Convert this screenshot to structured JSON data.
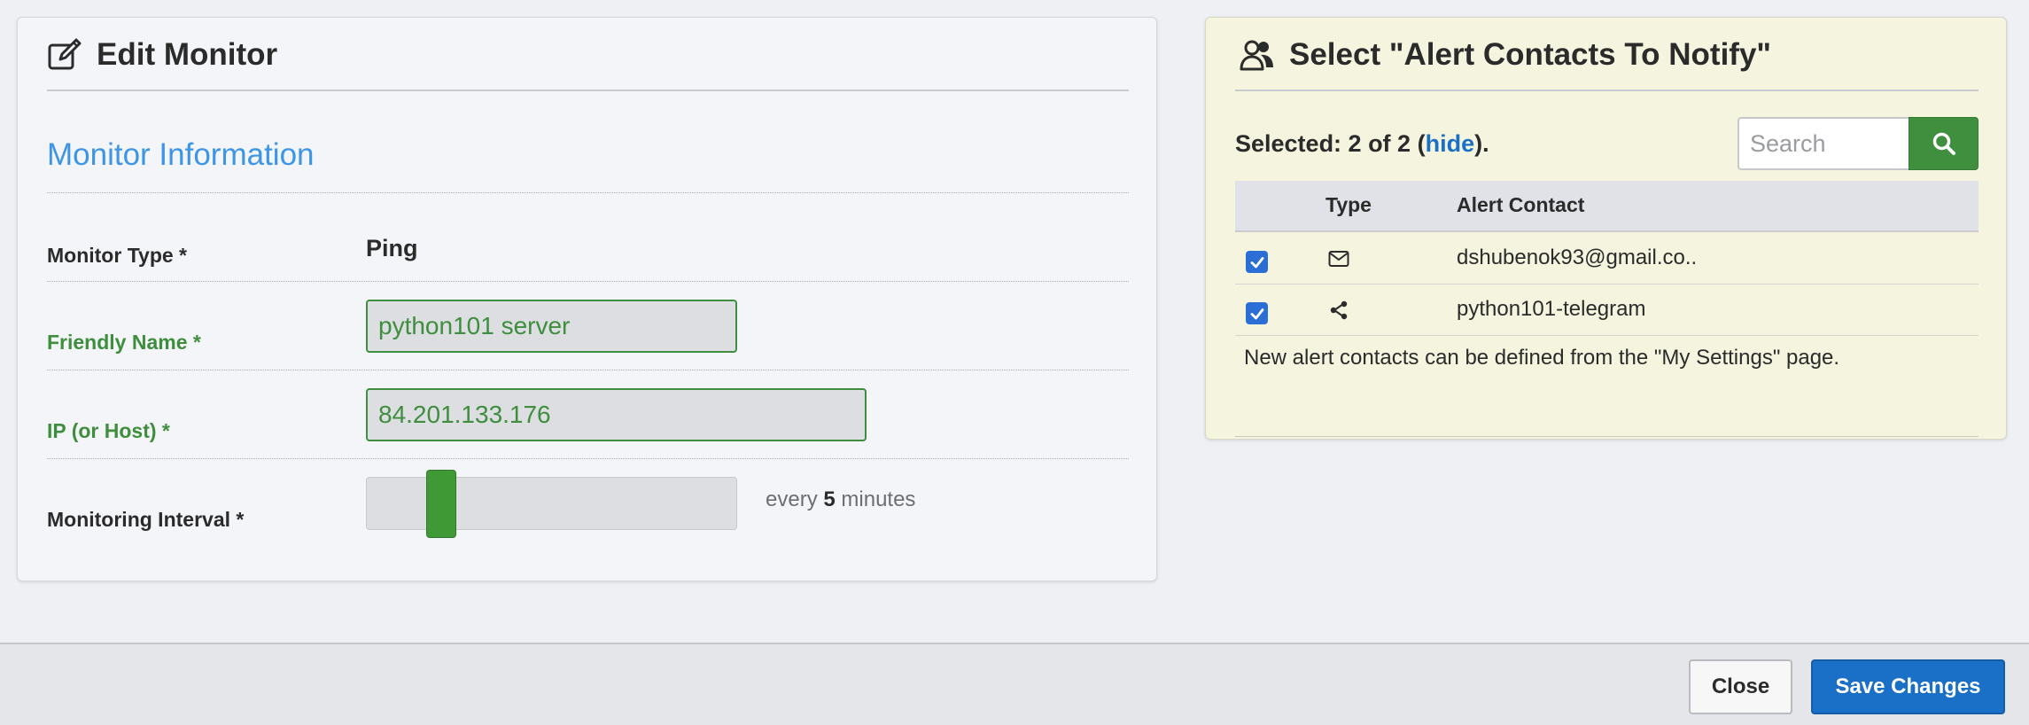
{
  "edit_monitor": {
    "title": "Edit Monitor",
    "title_icon": "edit-icon",
    "section_title": "Monitor Information",
    "monitor_type": {
      "label": "Monitor Type *",
      "value": "Ping"
    },
    "friendly_name": {
      "label": "Friendly Name *",
      "value": "python101 server"
    },
    "ip_host": {
      "label": "IP (or Host) *",
      "value": "84.201.133.176"
    },
    "monitoring_interval": {
      "label": "Monitoring Interval *",
      "prefix": "every",
      "value": "5",
      "suffix": "minutes"
    }
  },
  "alert_contacts": {
    "title": "Select \"Alert Contacts To Notify\"",
    "title_icon": "users-icon",
    "selected_prefix": "Selected: 2 of 2 (",
    "hide_link": "hide",
    "selected_suffix": ").",
    "search_placeholder": "Search",
    "search_icon": "search-icon",
    "columns": {
      "type": "Type",
      "contact": "Alert Contact"
    },
    "rows": [
      {
        "checked": true,
        "type_icon": "envelope-icon",
        "contact": "dshubenok93@gmail.co.."
      },
      {
        "checked": true,
        "type_icon": "share-icon",
        "contact": "python101-telegram"
      }
    ],
    "help_text": "New alert contacts can be defined from the \"My Settings\" page."
  },
  "footer": {
    "close_label": "Close",
    "save_label": "Save Changes"
  },
  "colors": {
    "accent_blue": "#1a6fc6",
    "section_blue": "#3c95e6",
    "valid_green": "#3e8e3e",
    "slider_green": "#3f9a35",
    "right_panel_bg": "#f4f4df"
  }
}
